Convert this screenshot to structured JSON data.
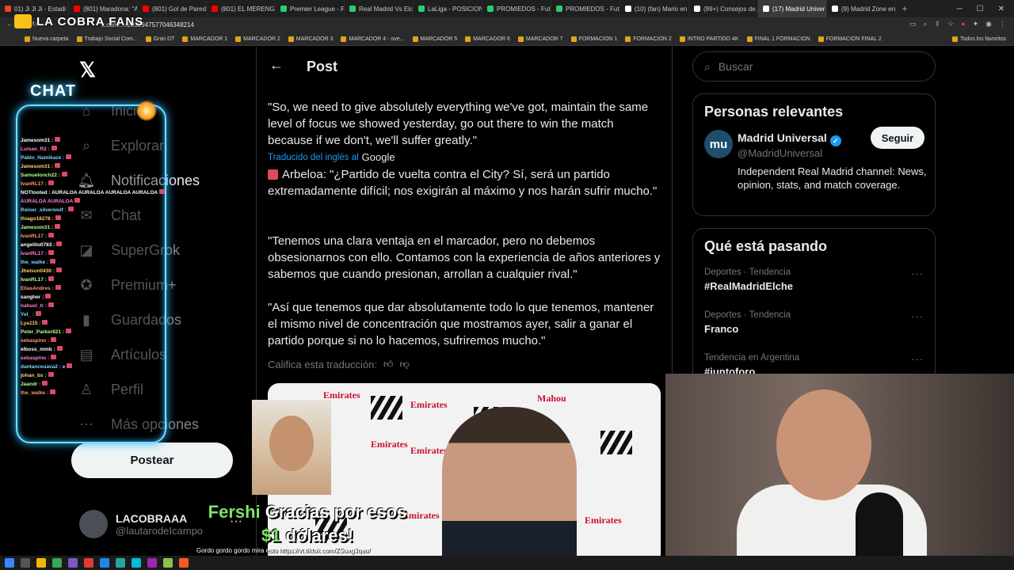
{
  "browser": {
    "tabs": [
      {
        "title": "01) Ji Ji Ji - Estadi",
        "color": "#ff3b30"
      },
      {
        "title": "(801) Maradona: \"A",
        "color": "#ff0000"
      },
      {
        "title": "(801) Gol de Pared",
        "color": "#ff0000"
      },
      {
        "title": "(801) EL MERENGUE",
        "color": "#ff0000"
      },
      {
        "title": "Premier League - P",
        "color": "#2ecc71"
      },
      {
        "title": "Real Madrid Vs Elch",
        "color": "#2ecc71"
      },
      {
        "title": "LaLiga - POSICION",
        "color": "#2ecc71"
      },
      {
        "title": "PROMIEDOS - Futb",
        "color": "#2ecc71"
      },
      {
        "title": "PROMIEDOS - Futb",
        "color": "#2ecc71"
      },
      {
        "title": "(10) (fan) Mario en",
        "color": "#ffffff"
      },
      {
        "title": "(99+) Consejos de A",
        "color": "#ffffff"
      },
      {
        "title": "(17) Madrid Univer",
        "color": "#ffffff"
      },
      {
        "title": "(9) Madrid Zone en",
        "color": "#ffffff"
      }
    ],
    "active_tab": 11,
    "url": "x.com/.../2032947577046348214",
    "bookmarks": [
      "Nueva carpeta",
      "Trabajo Social Com...",
      "Gran DT",
      "MARCADOR 1",
      "MARCADOR 2",
      "MARCADOR 3",
      "MARCADOR 4 - ove...",
      "MARCADOR 5",
      "MARCADOR 6",
      "MARCADOR 7",
      "FORMACION 1",
      "FORMACION 2",
      "INTRO PARTIDO 4K",
      "FINAL 1 FORMACION",
      "FORMACION FINAL 2"
    ],
    "bookmarks_right": "Todos los favoritos"
  },
  "overlay": {
    "logo_text": "LA COBRA FANS",
    "chat_title": "CHAT",
    "chat_lines": [
      "Jamesom31 :",
      "Luisao_R2 :",
      "Pablo_Namikaze :",
      "Jamesom31 :",
      "Samuelonch22 :",
      "IvanRL17 :",
      "NOTtooted : AURALOA AURALOA AURALOA AURALOA",
      "AURALOA AURALOA",
      "Reiner_silverwolf :",
      "thiago18278 :",
      "Jamesom31 :",
      "IvanRL17 :",
      "angelito0783 :",
      "IvanRL17 :",
      "the_walke :",
      "Jhelson0430 :",
      "IvanRL17 :",
      "EliasAndres :",
      "sangher :",
      "nahuel_tr :",
      "Yel_ :",
      "Lya115 :",
      "Peter_Parker821 :",
      "sebaspino :",
      "elboss_mmb :",
      "sebaspino :",
      "dantanceuava2 : e",
      "johan_bs :",
      "Jaandr :",
      "the_walke :"
    ],
    "alert_name": "Fershi",
    "alert_line1": "Gracias por esos",
    "alert_amount": "$1",
    "alert_line2": "dólares!",
    "ticker": "Gordo gordo gordo mira esto https://vt.tiktok.com/ZSuag3qau/"
  },
  "sidebar": {
    "nav": [
      {
        "label": "Inicio",
        "icon": "home-icon"
      },
      {
        "label": "Explorar",
        "icon": "search-icon"
      },
      {
        "label": "Notificaciones",
        "icon": "bell-icon"
      },
      {
        "label": "Chat",
        "icon": "mail-icon"
      },
      {
        "label": "SuperGrok",
        "icon": "grok-icon"
      },
      {
        "label": "Premium+",
        "icon": "verified-icon"
      },
      {
        "label": "Guardados",
        "icon": "bookmark-icon"
      },
      {
        "label": "Artículos",
        "icon": "article-icon"
      },
      {
        "label": "Perfil",
        "icon": "person-icon"
      },
      {
        "label": "Más opciones",
        "icon": "more-icon"
      }
    ],
    "post_button": "Postear",
    "account_name": "LACOBRAAA",
    "account_handle": "@lautarodeIcampo"
  },
  "post": {
    "header_title": "Post",
    "quote_en": "\"So, we need to give absolutely everything we've got, maintain the same level of focus we showed yesterday, go out there to win the match because if we don't, we'll suffer greatly.\"",
    "translated_label": "Traducido del inglés al",
    "translated_brand": "Google",
    "para1": "Arbeloa: \"¿Partido de vuelta contra el City? Sí, será un partido extremadamente difícil; nos exigirán al máximo y nos harán sufrir mucho.\"",
    "para2": "\"Tenemos una clara ventaja en el marcador, pero no debemos obsesionarnos con ello. Contamos con la experiencia de años anteriores y sabemos que cuando presionan, arrollan a cualquier rival.\"",
    "para3": "\"Así que tenemos que dar absolutamente todo lo que tenemos, mantener el mismo nivel de concentración que mostramos ayer, salir a ganar el partido porque si no lo hacemos, sufriremos mucho.\"",
    "rate_label": "Califica esta traducción:",
    "media_labels": [
      "Emirates",
      "Emirates",
      "Mahou",
      "Emirates",
      "Emirates",
      "Emirates",
      "Mahou",
      "hp",
      "Emirates",
      "hp",
      "Emirates"
    ]
  },
  "right": {
    "search_placeholder": "Buscar",
    "relevant_title": "Personas relevantes",
    "person_logo": "mu",
    "person_name": "Madrid Universal",
    "person_handle": "@MadridUniversal",
    "follow_label": "Seguir",
    "person_bio": "Independent Real Madrid channel: News, opinion, stats, and match coverage.",
    "trending_title": "Qué está pasando",
    "trends": [
      {
        "category": "Deportes · Tendencia",
        "title": "#RealMadridElche"
      },
      {
        "category": "Deportes · Tendencia",
        "title": "Franco"
      },
      {
        "category": "Tendencia en Argentina",
        "title": "#juntoforo"
      }
    ]
  },
  "colors": {
    "accent": "#1d9bf0",
    "chat_glow": "#38c6ff",
    "alert_name": "#7fe36a"
  }
}
